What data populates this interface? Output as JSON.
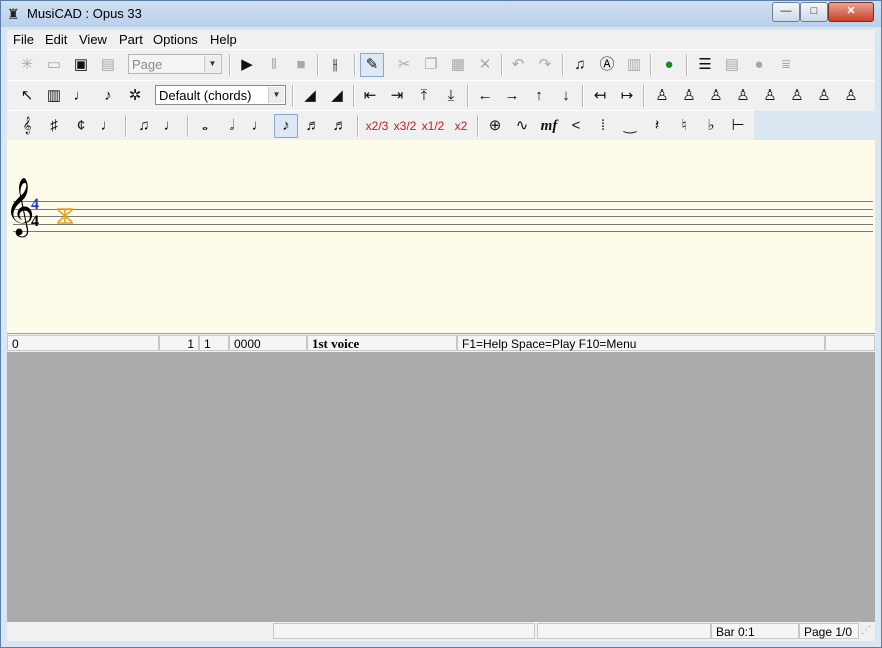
{
  "window": {
    "title": "MusiCAD : Opus 33"
  },
  "window_controls": {
    "minimize": "—",
    "maximize": "□",
    "close": "✕"
  },
  "menu": {
    "file": "File",
    "edit": "Edit",
    "view": "View",
    "part": "Part",
    "options": "Options",
    "help": "Help"
  },
  "toolbar1": {
    "view_mode": "Page"
  },
  "toolbar2": {
    "chord_mode": "Default (chords)"
  },
  "toolbar3": {
    "tuplet_2_3": "x2/3",
    "tuplet_3_2": "x3/2",
    "tuplet_1_2": "x1/2",
    "tuplet_x2": "x2",
    "dynamic_mf": "mf"
  },
  "score": {
    "time_signature_top": "4",
    "time_signature_bottom": "4"
  },
  "status": {
    "position": "0",
    "bar": "1",
    "beat": "1",
    "tick": "0000",
    "voice": "1st voice",
    "hint": "F1=Help Space=Play F10=Menu"
  },
  "bottom_status": {
    "bar": "Bar 0:1",
    "page": "Page 1/0"
  },
  "colors": {
    "score_bg": "#fffbeb",
    "lower_pane": "#ababab",
    "cursor": "#e8a317",
    "accent_blue": "#1c3fc8"
  }
}
